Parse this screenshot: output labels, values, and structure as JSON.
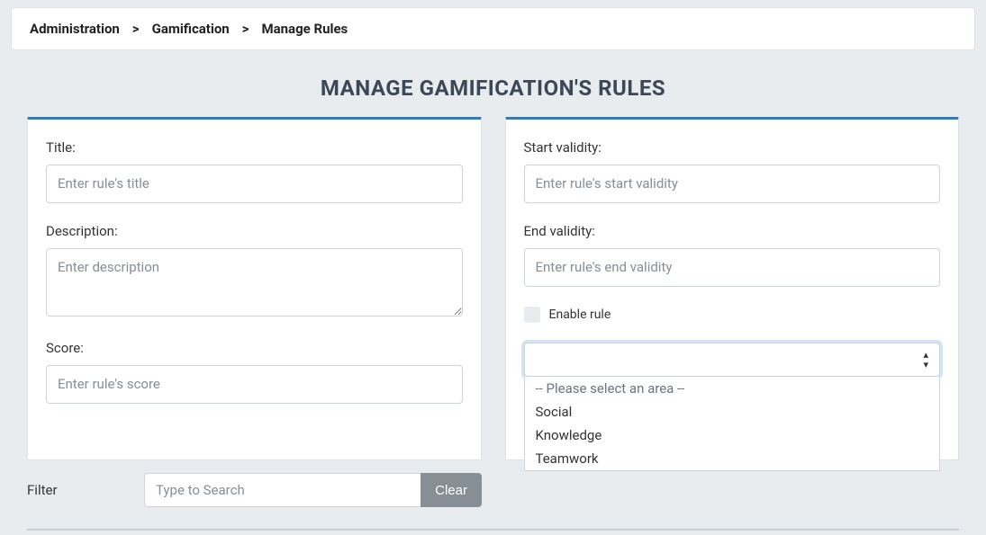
{
  "breadcrumb": {
    "items": [
      "Administration",
      "Gamification",
      "Manage Rules"
    ],
    "separator": ">"
  },
  "page": {
    "title": "MANAGE GAMIFICATION'S RULES"
  },
  "form": {
    "title": {
      "label": "Title:",
      "placeholder": "Enter rule's title",
      "value": ""
    },
    "description": {
      "label": "Description:",
      "placeholder": "Enter description",
      "value": ""
    },
    "score": {
      "label": "Score:",
      "placeholder": "Enter rule's score",
      "value": ""
    },
    "start_validity": {
      "label": "Start validity:",
      "placeholder": "Enter rule's start validity",
      "value": ""
    },
    "end_validity": {
      "label": "End validity:",
      "placeholder": "Enter rule's end validity",
      "value": ""
    },
    "enable": {
      "label": "Enable rule",
      "checked": false
    },
    "area": {
      "selected": "",
      "options": [
        "-- Please select an area --",
        "Social",
        "Knowledge",
        "Teamwork"
      ]
    }
  },
  "filter": {
    "label": "Filter",
    "placeholder": "Type to Search",
    "value": "",
    "clear_label": "Clear"
  }
}
